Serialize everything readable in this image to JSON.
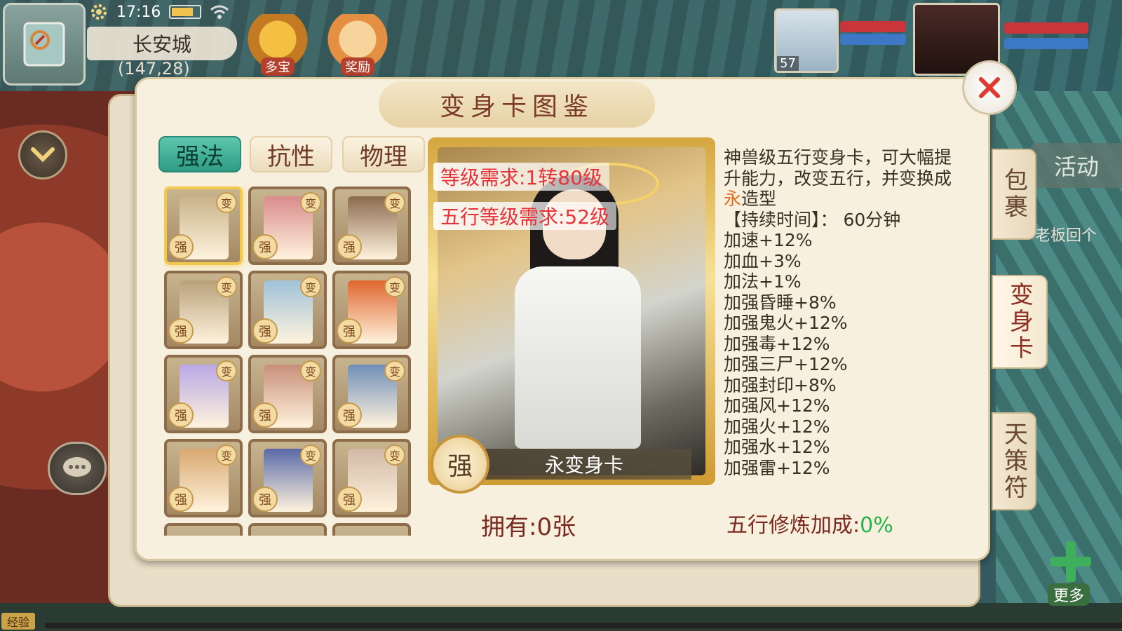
{
  "status_bar": {
    "time": "17:16"
  },
  "location": {
    "city": "长安城",
    "coords": "(147,28)"
  },
  "top_icons": {
    "treasure_label": "多宝",
    "reward_label": "奖励"
  },
  "pet": {
    "level": "57"
  },
  "side_tabs": {
    "bag": "包裹",
    "card": "变身卡",
    "talisman": "天策符"
  },
  "hud": {
    "activity_label": "活动",
    "ticker_text": "老板回个",
    "more_label": "更多",
    "exp_label": "经验",
    "exp_fraction": 0
  },
  "panel": {
    "title": "变身卡图鉴",
    "close_icon": "close-icon",
    "tabs": [
      {
        "label": "强法",
        "active": true
      },
      {
        "label": "抗性",
        "active": false
      },
      {
        "label": "物理",
        "active": false
      }
    ],
    "card_badge_bian": "变",
    "card_badge_qiang": "强",
    "cards": [
      {
        "color": "#c9b38a",
        "selected": true
      },
      {
        "color": "#d98c8c",
        "selected": false
      },
      {
        "color": "#8c6a4e",
        "selected": false
      },
      {
        "color": "#b9a17a",
        "selected": false
      },
      {
        "color": "#9fc2d9",
        "selected": false
      },
      {
        "color": "#e0662f",
        "selected": false
      },
      {
        "color": "#b9a7e6",
        "selected": false
      },
      {
        "color": "#c88f7a",
        "selected": false
      },
      {
        "color": "#6f8fb8",
        "selected": false
      },
      {
        "color": "#d8a870",
        "selected": false
      },
      {
        "color": "#5a6aa8",
        "selected": false
      },
      {
        "color": "#d1b9a6",
        "selected": false
      }
    ],
    "selected_card": {
      "level_requirement": "等级需求:1转80级",
      "wuxing_requirement": "五行等级需求:52级",
      "strength_badge": "强",
      "name": "永变身卡",
      "description_before": "神兽级五行变身卡，可大幅提升能力，改变五行，并变换成",
      "description_highlight": "永",
      "description_after": "造型",
      "duration": "【持续时间】： 60分钟",
      "stats": [
        "加速+12%",
        "加血+3%",
        "加法+1%",
        "加强昏睡+8%",
        "加强鬼火+12%",
        "加强毒+12%",
        "加强三尸+12%",
        "加强封印+8%",
        "加强风+12%",
        "加强火+12%",
        "加强水+12%",
        "加强雷+12%"
      ]
    },
    "owned": "拥有:0张",
    "bonus_label": "五行修炼加成:",
    "bonus_value": "0%"
  },
  "colors": {
    "accent_tab": "#2f9c86",
    "requirement_red": "#e8323a",
    "bonus_green": "#25b34a",
    "highlight_orange": "#e46b1f"
  }
}
